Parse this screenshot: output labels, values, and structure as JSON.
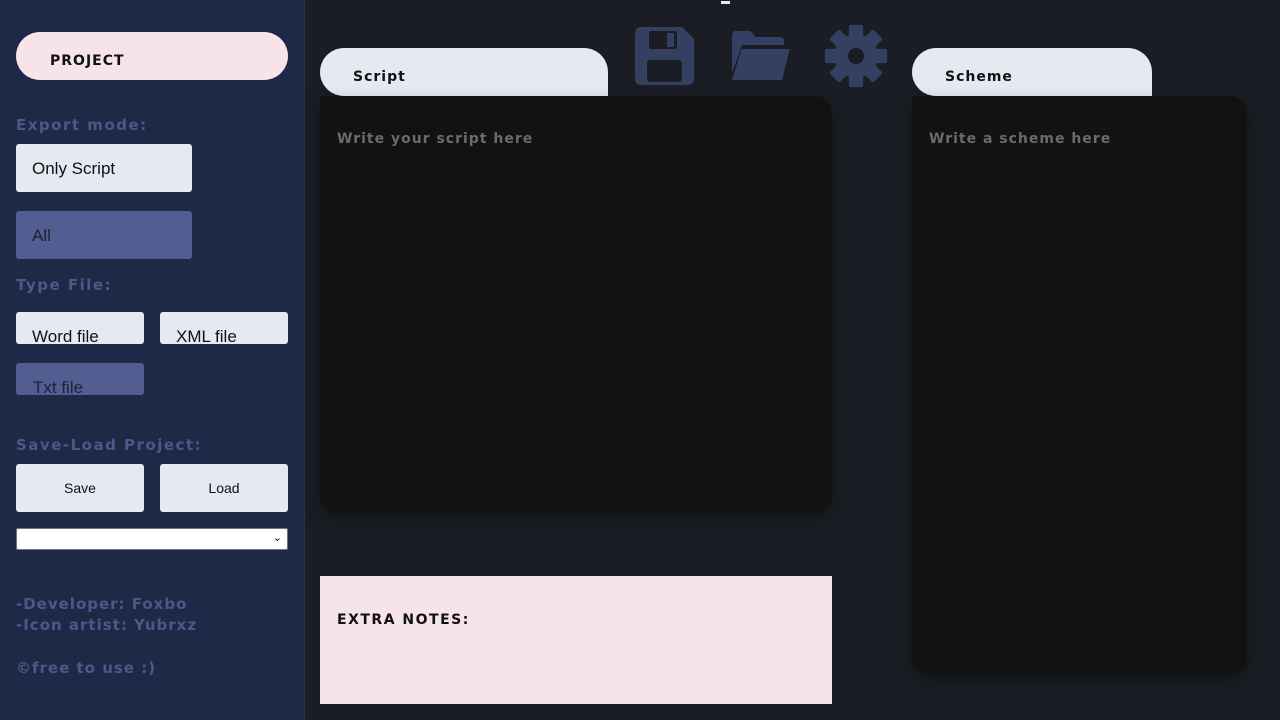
{
  "sidebar": {
    "project_label": "PROJECT",
    "export_mode_label": "Export mode:",
    "export_only_script": "Only Script",
    "export_all": "All",
    "type_file_label": "Type File:",
    "word_file": "Word file",
    "xml_file": "XML file",
    "txt_file": "Txt file",
    "save_load_label": "Save-Load Project:",
    "save": "Save",
    "load": "Load",
    "select_value": "",
    "developer": "-Developer: Foxbo",
    "icon_artist": "-Icon artist: Yubrxz",
    "license": "©free to use :)"
  },
  "toolbar": {
    "icons": [
      "save-disk-icon",
      "open-folder-icon",
      "settings-gear-icon"
    ],
    "icon_color": "#353f62"
  },
  "script": {
    "tab_label": "Script",
    "placeholder": "Write your script here"
  },
  "scheme": {
    "tab_label": "Scheme",
    "placeholder": "Write a scheme here"
  },
  "notes": {
    "label": "EXTRA NOTES:"
  },
  "colors": {
    "background": "#1a1e24",
    "sidebar": "#202848",
    "pill_light": "#e4e9f2",
    "pill_pink": "#f6e4ea",
    "button_selected": "#525d92",
    "label_muted": "#4b5889",
    "editor": "#121212"
  }
}
